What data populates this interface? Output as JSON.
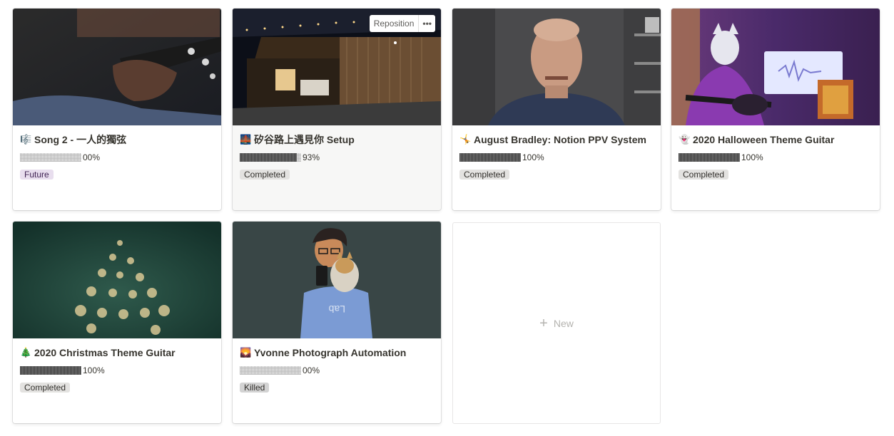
{
  "cards": [
    {
      "title": "Song 2 - 一人的獨弦",
      "emoji": "🎼",
      "progress_bar": "░░░░░░░░░░",
      "progress": 0,
      "progress_text": "00%",
      "status": "Future",
      "cover": "guitar-hands-photo"
    },
    {
      "title": "矽谷路上遇見你 Setup",
      "emoji": "🌉",
      "progress_bar": "▓▓▓▓▓▓▓▓▓░",
      "progress": 0.93,
      "progress_text": "93%",
      "status": "Completed",
      "cover": "backyard-night-photo"
    },
    {
      "title": "August Bradley: Notion PPV System",
      "emoji": "🤸",
      "progress_bar": "▓▓▓▓▓▓▓▓▓▓",
      "progress": 1.0,
      "progress_text": "100%",
      "status": "Completed",
      "cover": "bald-man-portrait-photo"
    },
    {
      "title": "2020 Halloween Theme Guitar",
      "emoji": "👻",
      "progress_bar": "▓▓▓▓▓▓▓▓▓▓",
      "progress": 1.0,
      "progress_text": "100%",
      "status": "Completed",
      "cover": "masked-guitarist-photo"
    },
    {
      "title": "2020 Christmas Theme Guitar",
      "emoji": "🎄",
      "progress_bar": "▓▓▓▓▓▓▓▓▓▓",
      "progress": 1.0,
      "progress_text": "100%",
      "status": "Completed",
      "cover": "christmas-tree-bokeh-photo"
    },
    {
      "title": "Yvonne Photograph Automation",
      "emoji": "🌄",
      "progress_bar": "░░░░░░░░░░",
      "progress": 0,
      "progress_text": "00%",
      "status": "Killed",
      "cover": "man-with-cat-illustration"
    }
  ],
  "cover_actions": {
    "reposition_label": "Reposition",
    "more_label": "•••"
  },
  "new_card": {
    "plus": "+",
    "label": "New"
  },
  "colors": {
    "future_tag": "#e8deee",
    "completed_tag": "#e3e2e0",
    "killed_tag": "#d3d3d3"
  }
}
